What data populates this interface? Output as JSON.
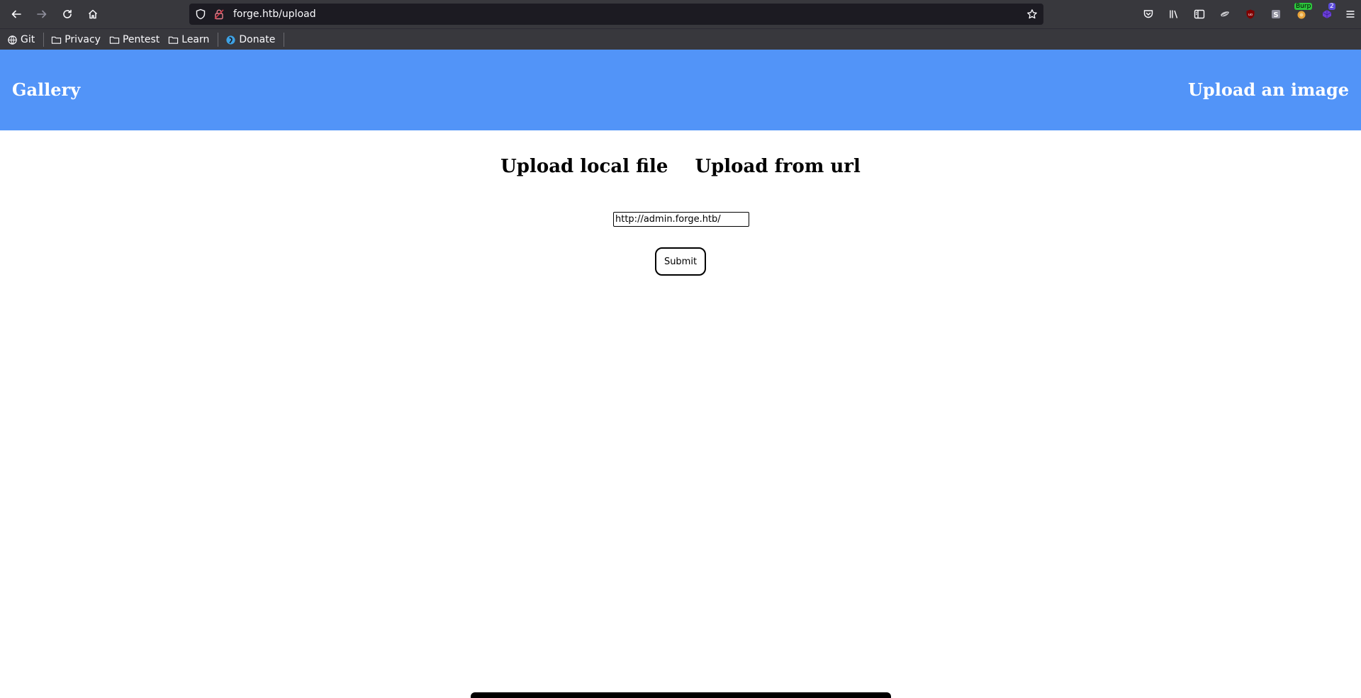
{
  "browser": {
    "url": "forge.htb/upload",
    "bookmarks": [
      {
        "label": "Git",
        "icon": "globe-icon"
      },
      {
        "label": "Privacy",
        "icon": "folder-icon"
      },
      {
        "label": "Pentest",
        "icon": "folder-icon"
      },
      {
        "label": "Learn",
        "icon": "folder-icon"
      },
      {
        "label": "Donate",
        "icon": "donate-icon"
      }
    ],
    "extensions": {
      "burp_badge": "Burp",
      "container_badge": "2"
    }
  },
  "site": {
    "brand": "Gallery",
    "nav_link": "Upload an image"
  },
  "upload": {
    "tab_local": "Upload local file",
    "tab_url": "Upload from url",
    "url_value": "http://admin.forge.htb/",
    "submit_label": "Submit"
  },
  "colors": {
    "header_bg": "#5294f8",
    "chrome_bg": "#38383d",
    "urlbar_bg": "#1c1b22"
  }
}
